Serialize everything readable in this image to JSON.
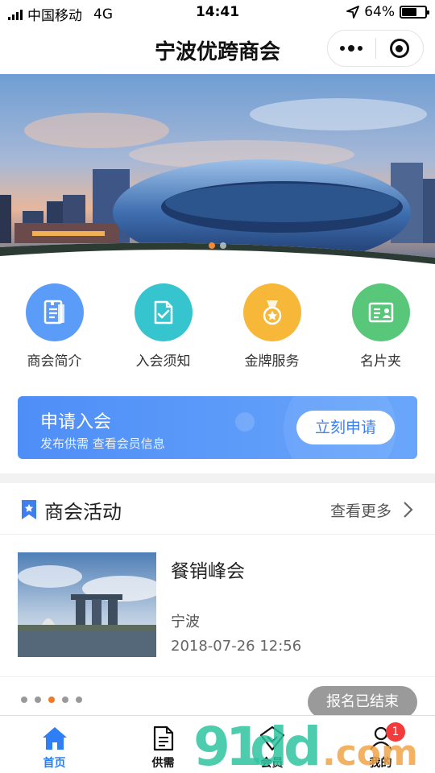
{
  "status_bar": {
    "carrier": "中国移动",
    "network": "4G",
    "time": "14:41",
    "battery": "64%",
    "battery_level": 0.64
  },
  "navbar": {
    "title": "宁波优跨商会",
    "more_icon": "more-dots-icon",
    "close_icon": "target-icon"
  },
  "banner": {
    "slide_count": 2,
    "active_slide": 0
  },
  "quick_entries": [
    {
      "label": "商会简介",
      "icon": "chamber-intro-icon",
      "color": "#5b9cf8"
    },
    {
      "label": "入会须知",
      "icon": "membership-notice-icon",
      "color": "#36c5cf"
    },
    {
      "label": "金牌服务",
      "icon": "gold-medal-icon",
      "color": "#f7b738"
    },
    {
      "label": "名片夹",
      "icon": "business-card-icon",
      "color": "#59c77a"
    }
  ],
  "apply": {
    "title": "申请入会",
    "subtitle": "发布供需 查看会员信息",
    "button": "立刻申请"
  },
  "activities": {
    "title": "商会活动",
    "more": "查看更多",
    "items": [
      {
        "name": "餐销峰会",
        "city": "宁波",
        "time": "2018-07-26 12:56",
        "status": "报名已结束"
      }
    ],
    "page_count": 5,
    "active_page": 2
  },
  "tabbar": [
    {
      "label": "首页",
      "icon": "home-icon",
      "active": true
    },
    {
      "label": "供需",
      "icon": "document-icon",
      "active": false
    },
    {
      "label": "会员",
      "icon": "diamond-icon",
      "active": false
    },
    {
      "label": "我的",
      "icon": "user-icon",
      "active": false,
      "badge": "1"
    }
  ],
  "colors": {
    "accent": "#2e7ff5",
    "badge": "#f43b3b",
    "active_dot": "#f07a2c"
  }
}
